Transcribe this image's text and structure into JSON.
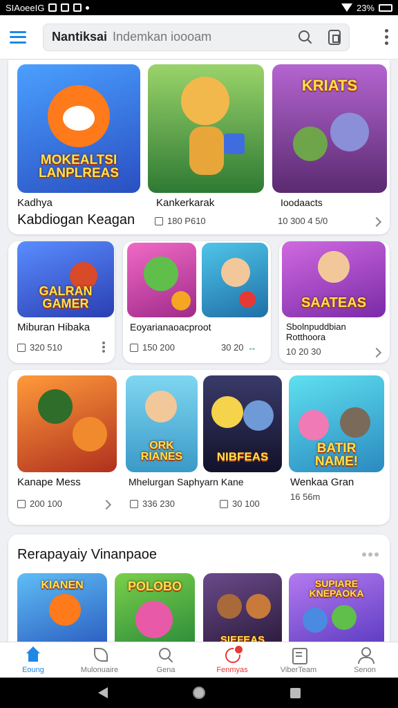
{
  "status_bar": {
    "left_text": "SIAoeeIG",
    "right_text": "23%"
  },
  "search": {
    "app_name": "Nantiksai",
    "placeholder": "Indemkan ioooam"
  },
  "featured": {
    "tiles": [
      {
        "name": "Kadhya",
        "logo": "MOKEALTSI LANPLREAS",
        "bg": "#2f6fd8",
        "accent": "#ff7a1a"
      },
      {
        "name": "Kankerkarak",
        "logo": "",
        "bg": "#2e9a3f",
        "accent": "#f2b84b"
      },
      {
        "name": "Ioodaacts",
        "logo": "KRIATS",
        "bg": "#8c4aa8",
        "accent": "#e25a2f"
      }
    ],
    "title": "Kabdiogan Keagan",
    "meta": [
      {
        "icon": "download-icon",
        "text": "180 P610"
      },
      {
        "icon": "",
        "text": "10 300 4 5/0"
      }
    ]
  },
  "row2": [
    {
      "name": "Miburan Hibaka",
      "logo": "GALRAN GAMER",
      "bg": "#3a5ad6",
      "meta": "320 510",
      "accent": "#f5c43a"
    },
    {
      "name": "Eoyarianaoacproot",
      "logo": "",
      "bg": "#d44fb5",
      "meta": "150 200",
      "meta2": "30 20",
      "accent": "#5fbf4a"
    },
    {
      "name": "Sbolnpuddbian Rotthoora",
      "logo": "SAATEAS",
      "bg": "#b14cc8",
      "meta": "10 20 30",
      "accent": "#ffb347"
    }
  ],
  "row3": [
    {
      "name": "Kanape Mess",
      "logo": "",
      "bg": "#c6402f",
      "meta": "200 100",
      "accent": "#f08a2c"
    },
    {
      "name": "Mhelurgan Saphyarn Kane",
      "logo": "ORK RIANES",
      "bg": "#3cb4d8",
      "meta": "336 230",
      "meta2": "30 100",
      "accent": "#f5d34a"
    },
    {
      "name": "Wenkaa Gran",
      "logo": "BATIR NAME!",
      "bg": "#3ab0d0",
      "meta": "16 56m",
      "accent": "#f7c43a"
    }
  ],
  "row3_logos": [
    "NIBFEAS"
  ],
  "section2": {
    "title": "Rerapayaiy Vinanpaoe",
    "tiles": [
      {
        "logo": "KIANEN",
        "bg": "#2e7fd4"
      },
      {
        "logo": "POLOBO",
        "bg": "#2e9a3f"
      },
      {
        "logo": "SIEFEAS",
        "bg": "#5a3a7a"
      },
      {
        "logo": "SUPIARE KNEPAOKA",
        "bg": "#8a4ac8"
      }
    ]
  },
  "bottom_nav": [
    {
      "label": "Eoung",
      "icon": "home-icon"
    },
    {
      "label": "Mulonuaire",
      "icon": "leaf-icon"
    },
    {
      "label": "Gena",
      "icon": "search-icon"
    },
    {
      "label": "Fenmyas",
      "icon": "bell-icon"
    },
    {
      "label": "ViberTeam",
      "icon": "list-icon"
    },
    {
      "label": "Senon",
      "icon": "user-icon"
    }
  ]
}
